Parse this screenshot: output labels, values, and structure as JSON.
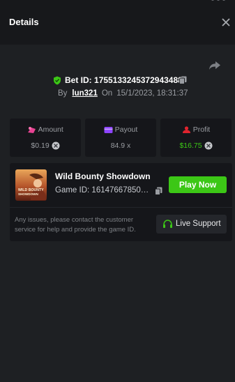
{
  "header": {
    "title": "Details",
    "close_icon": "close-icon"
  },
  "bet": {
    "label": "Bet ID:",
    "id": "1755133245372943488",
    "by_label": "By",
    "username": "lun321",
    "on_label": "On",
    "datetime": "15/1/2023, 18:31:37"
  },
  "stats": {
    "amount": {
      "label": "Amount",
      "value": "$0.19",
      "color": "#e84393"
    },
    "payout": {
      "label": "Payout",
      "value": "84.9 x",
      "color": "#8e44ff"
    },
    "profit": {
      "label": "Profit",
      "value": "$16.75",
      "color": "#e0242e",
      "value_color": "#3cc716"
    }
  },
  "game": {
    "name": "Wild Bounty Showdown",
    "id_label": "Game ID:",
    "id": "1614766785088...",
    "thumb_text_line1": "WILD BOUNTY",
    "thumb_text_line2": "SHOWDOWN",
    "play_label": "Play Now"
  },
  "support": {
    "note": "Any issues, please contact the customer service for help and provide the game ID.",
    "button_label": "Live Support"
  },
  "colors": {
    "accent_green": "#3cc716",
    "background": "#1e2023",
    "panel": "#15161a"
  }
}
